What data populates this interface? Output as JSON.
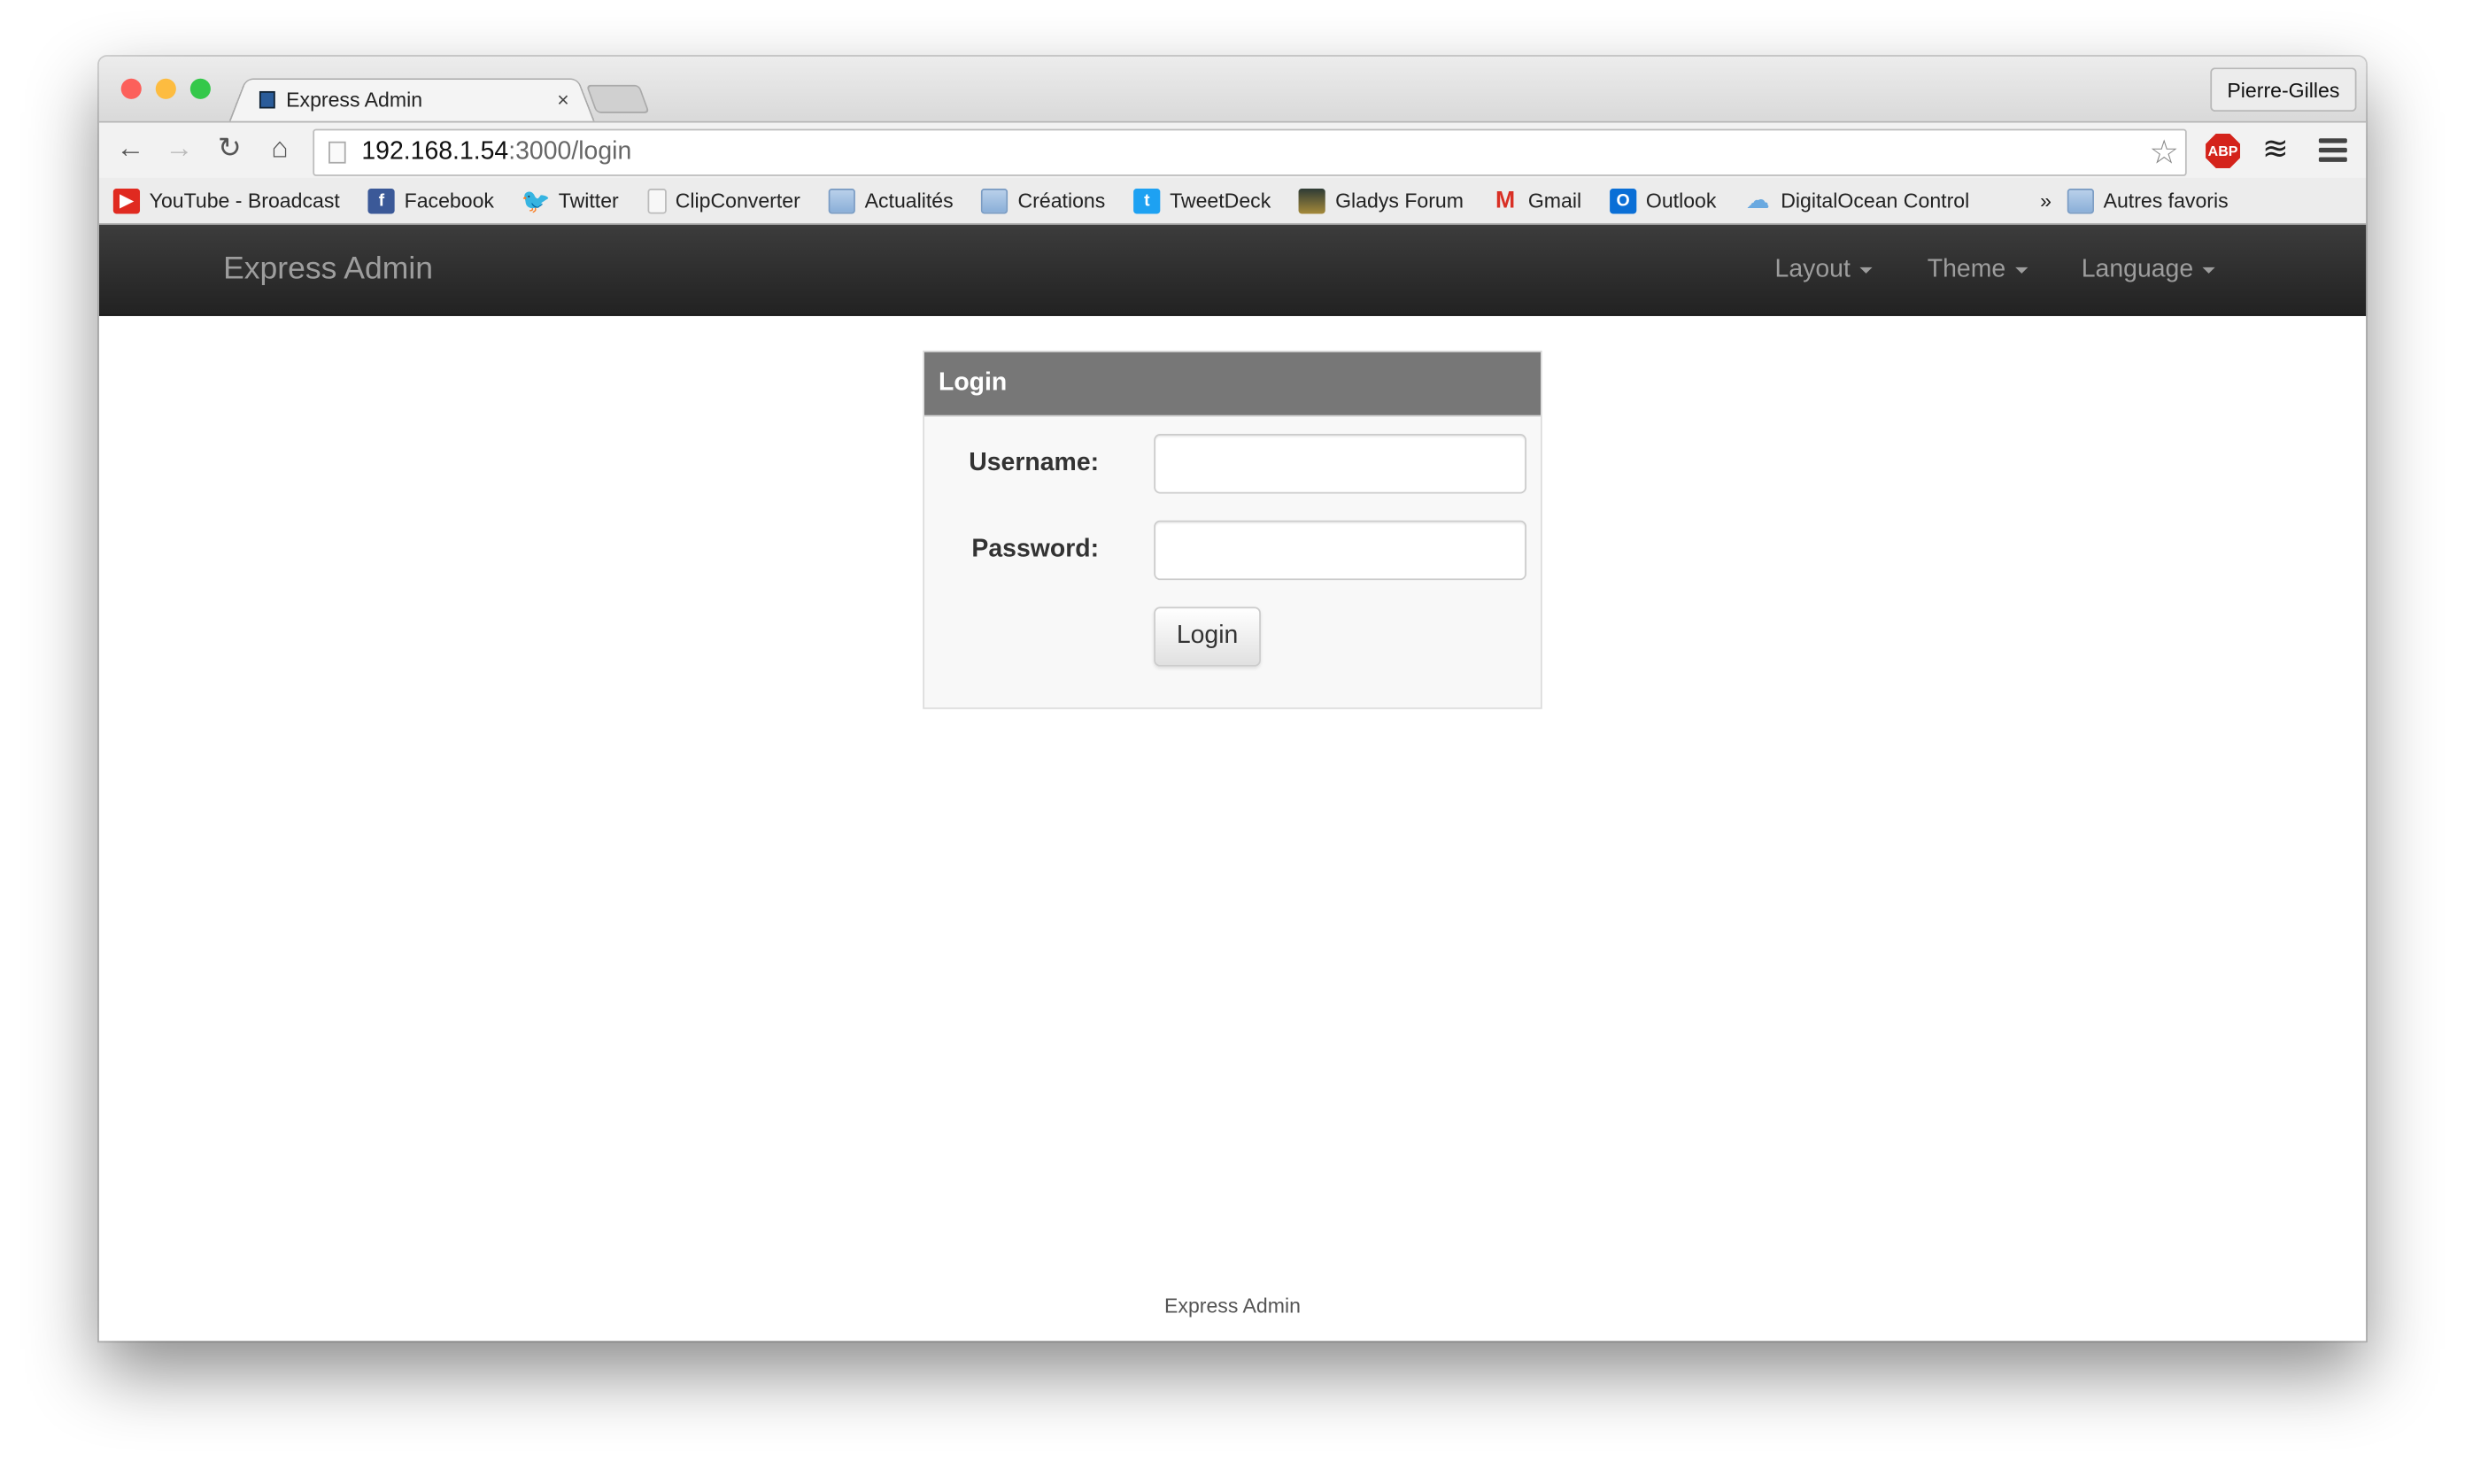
{
  "browser": {
    "tab_title": "Express Admin",
    "tab_close": "×",
    "profile_name": "Pierre-Gilles",
    "url_host": "192.168.1.54",
    "url_path": ":3000/login",
    "abp_label": "ABP",
    "bookmarks": [
      {
        "label": "YouTube - Broadcast",
        "icon": "youtube-icon",
        "color": "#e02a20"
      },
      {
        "label": "Facebook",
        "icon": "facebook-icon",
        "color": "#3b5998"
      },
      {
        "label": "Twitter",
        "icon": "twitter-icon",
        "color": "#55acee"
      },
      {
        "label": "ClipConverter",
        "icon": "page-icon",
        "color": "#f5f5f5"
      },
      {
        "label": "Actualités",
        "icon": "folder-icon",
        "color": "#9ebce0"
      },
      {
        "label": "Créations",
        "icon": "folder-icon",
        "color": "#9ebce0"
      },
      {
        "label": "TweetDeck",
        "icon": "tweetdeck-icon",
        "color": "#1da1f2"
      },
      {
        "label": "Gladys Forum",
        "icon": "gladys-icon",
        "color": "#3a4a3a"
      },
      {
        "label": "Gmail",
        "icon": "gmail-icon",
        "color": "#d93025"
      },
      {
        "label": "Outlook",
        "icon": "outlook-icon",
        "color": "#0a6fd6"
      },
      {
        "label": "DigitalOcean Control",
        "icon": "digitalocean-icon",
        "color": "#6aa9e0"
      }
    ],
    "overflow": "»",
    "other_bookmarks": "Autres favoris"
  },
  "navbar": {
    "brand": "Express Admin",
    "items": [
      {
        "label": "Layout"
      },
      {
        "label": "Theme"
      },
      {
        "label": "Language"
      }
    ]
  },
  "login": {
    "title": "Login",
    "username_label": "Username:",
    "username_value": "",
    "password_label": "Password:",
    "password_value": "",
    "submit_label": "Login"
  },
  "footer": {
    "text": "Express Admin"
  }
}
